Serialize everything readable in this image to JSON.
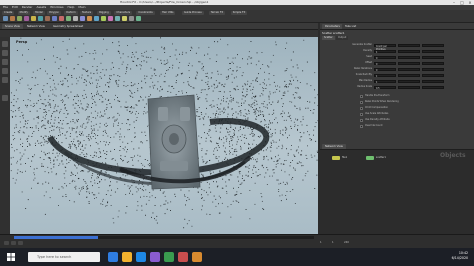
{
  "window": {
    "title": "Houdini FX - C:/Users/.../Projects/Fire_Crown.hip - /obj/geo1",
    "minimize_glyph": "–",
    "maximize_glyph": "□",
    "close_glyph": "×"
  },
  "menu": [
    "File",
    "Edit",
    "Render",
    "Assets",
    "Windows",
    "Help",
    "Main"
  ],
  "shelf": {
    "tabs": [
      "Create",
      "Modify",
      "Model",
      "Polygon",
      "Deform",
      "Texture",
      "Rigging",
      "Characters",
      "Constraints",
      "Hair Utils",
      "Guide Process",
      "Terrain FX",
      "Simple FX"
    ],
    "tool_colors": [
      "#6a8fb5",
      "#b57a4a",
      "#8aa85e",
      "#a05e9c",
      "#c9b34a",
      "#4fa0a6",
      "#9a6b54",
      "#6d7fc7",
      "#c46a6a",
      "#7ab37a",
      "#b2b2b2",
      "#8b8fd6",
      "#d0904f",
      "#5fa3c7",
      "#a7c95c",
      "#c774b4",
      "#70b0b0",
      "#cfcf6b",
      "#8f8f8f",
      "#6bb38e"
    ]
  },
  "viewport_tabs": [
    "Scene View",
    "Network View",
    "Geometry Spreadsheet"
  ],
  "viewport": {
    "label": "Persp",
    "camera": "No cam"
  },
  "params": {
    "tabs": [
      "Parameters",
      "Take List"
    ],
    "node_header": "Scatter  scatter1",
    "subtabs": [
      "Scatter",
      "Output"
    ],
    "rows": [
      {
        "label": "Generate Scatter",
        "values": [
          "Count per Primitive",
          "",
          ""
        ]
      },
      {
        "label": "Density",
        "values": [
          "1",
          "",
          ""
        ]
      },
      {
        "label": "Seed",
        "values": [
          "0",
          "",
          ""
        ]
      },
      {
        "label": "Offset",
        "values": [
          "0",
          "",
          ""
        ]
      },
      {
        "label": "Relax Iterations",
        "values": [
          "0",
          "",
          ""
        ]
      },
      {
        "label": "Scale Radii By",
        "values": [
          "1",
          "",
          ""
        ]
      },
      {
        "label": "Max Radius",
        "values": [
          "1",
          "",
          ""
        ]
      },
      {
        "label": "Radius Scale",
        "values": [
          "0.5",
          "",
          ""
        ]
      }
    ],
    "checks": [
      "Handle Pre-Transform",
      "Relax Points When Rendering",
      "Child Compensation",
      "Use Scale Attributes",
      "Use Density Attribute",
      "Override Count"
    ]
  },
  "network": {
    "watermark": "Objects",
    "nodes": [
      {
        "label": "file1",
        "color": "#c6c64e"
      },
      {
        "label": "scatter1",
        "color": "#6fbf6f"
      }
    ]
  },
  "timeline": {
    "frame": "1",
    "start": "1",
    "end": "240",
    "progress": 0.28
  },
  "taskbar": {
    "search_placeholder": "Type here to search",
    "time": "10:42",
    "date": "6/14/2020",
    "icon_colors": [
      "#2f7de1",
      "#f2b12e",
      "#1e88e5",
      "#8a5cd1",
      "#3a9b4f",
      "#c94e4e",
      "#d88a2f"
    ]
  }
}
